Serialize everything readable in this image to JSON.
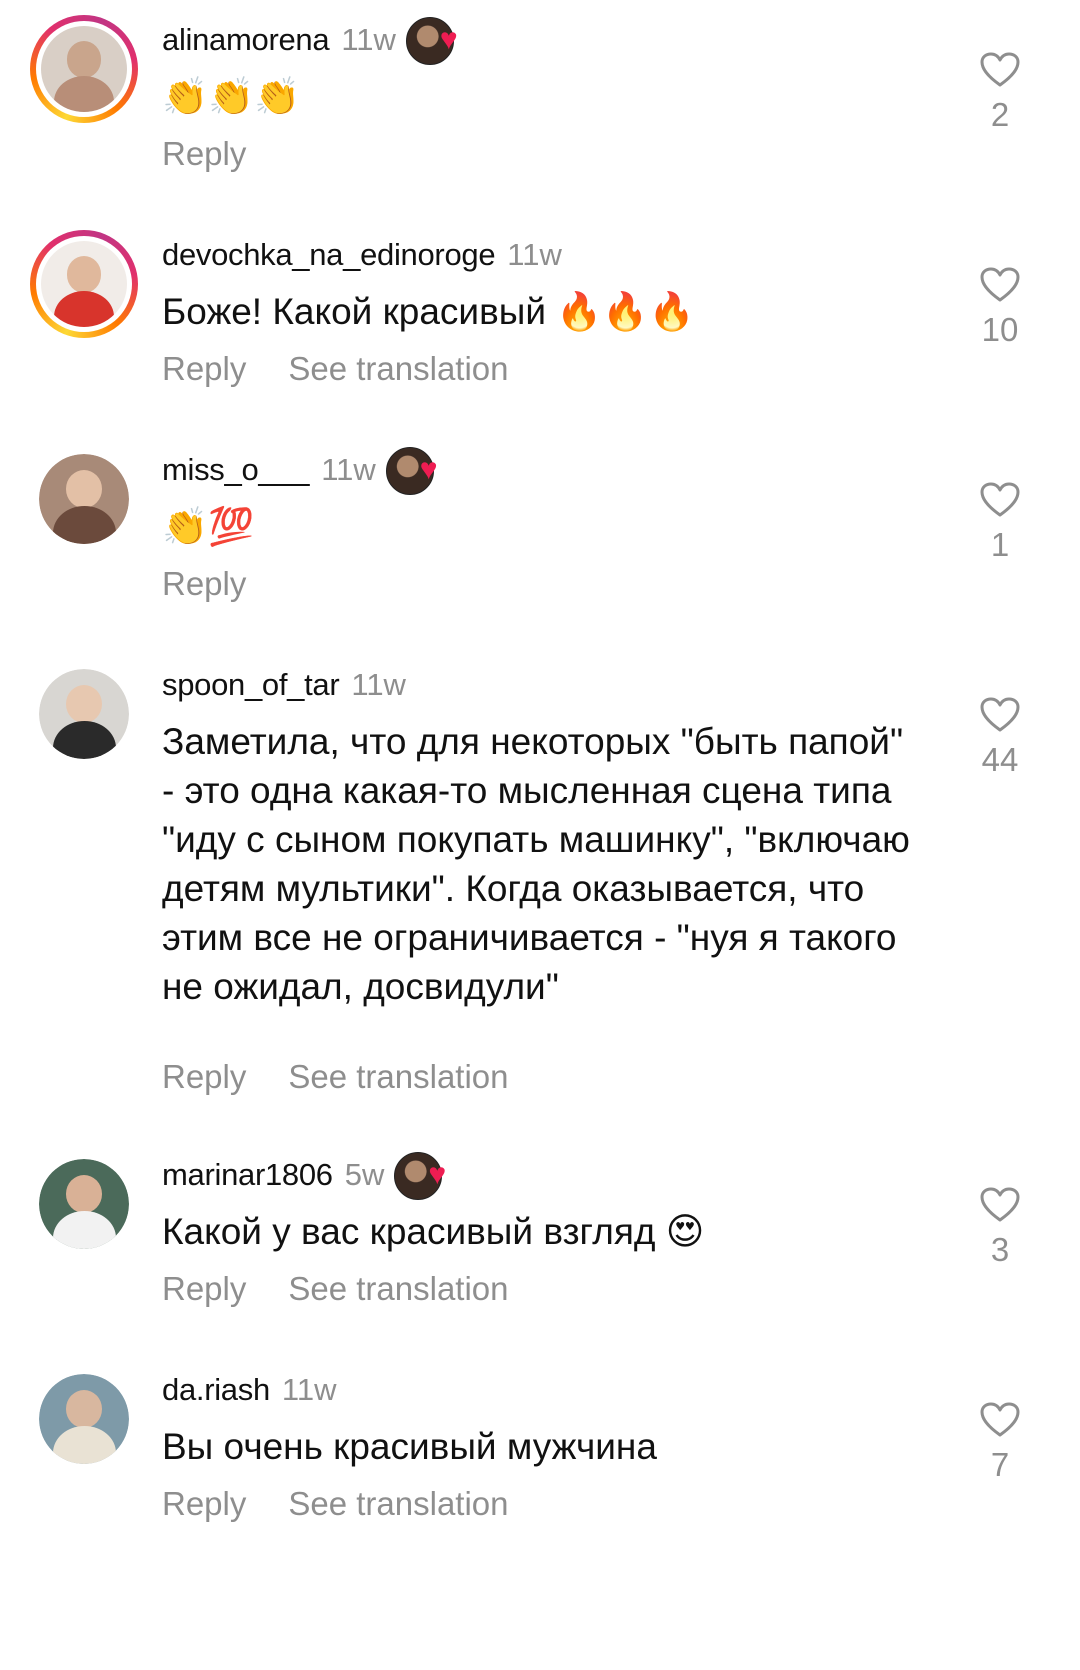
{
  "comments": [
    {
      "username": "alinamorena",
      "time": "11w",
      "text": "👏👏👏",
      "reply": "Reply",
      "see_translation": "",
      "likes": "2",
      "creator_liked": true,
      "story_ring": true
    },
    {
      "username": "devochka_na_edinoroge",
      "time": "11w",
      "text": "Боже! Какой красивый 🔥🔥🔥",
      "reply": "Reply",
      "see_translation": "See translation",
      "likes": "10",
      "creator_liked": false,
      "story_ring": true
    },
    {
      "username": "miss_o___",
      "time": "11w",
      "text": "👏💯",
      "reply": "Reply",
      "see_translation": "",
      "likes": "1",
      "creator_liked": true,
      "story_ring": false
    },
    {
      "username": "spoon_of_tar",
      "time": "11w",
      "text": "Заметила, что для некоторых \"быть папой\" - это одна какая-то мысленная сцена типа \"иду с сыном покупать машинку\", \"включаю детям мультики\". Когда оказывается, что этим все не ограничивается - \"нуя я такого не ожидал, досвидули\"",
      "reply": "Reply",
      "see_translation": "See translation",
      "likes": "44",
      "creator_liked": false,
      "story_ring": false
    },
    {
      "username": "marinar1806",
      "time": "5w",
      "text": "Какой у вас красивый взгляд 😍",
      "reply": "Reply",
      "see_translation": "See translation",
      "likes": "3",
      "creator_liked": true,
      "story_ring": false
    },
    {
      "username": "da.riash",
      "time": "11w",
      "text": "Вы очень красивый мужчина",
      "reply": "Reply",
      "see_translation": "See translation",
      "likes": "7",
      "creator_liked": false,
      "story_ring": false
    }
  ],
  "icons": {
    "like": "heart-outline-icon",
    "creator_like_badge": "heart-filled-icon"
  },
  "colors": {
    "secondary_text": "#8e8e8e",
    "heart_red": "#ee1d52",
    "primary_text": "#111111"
  }
}
